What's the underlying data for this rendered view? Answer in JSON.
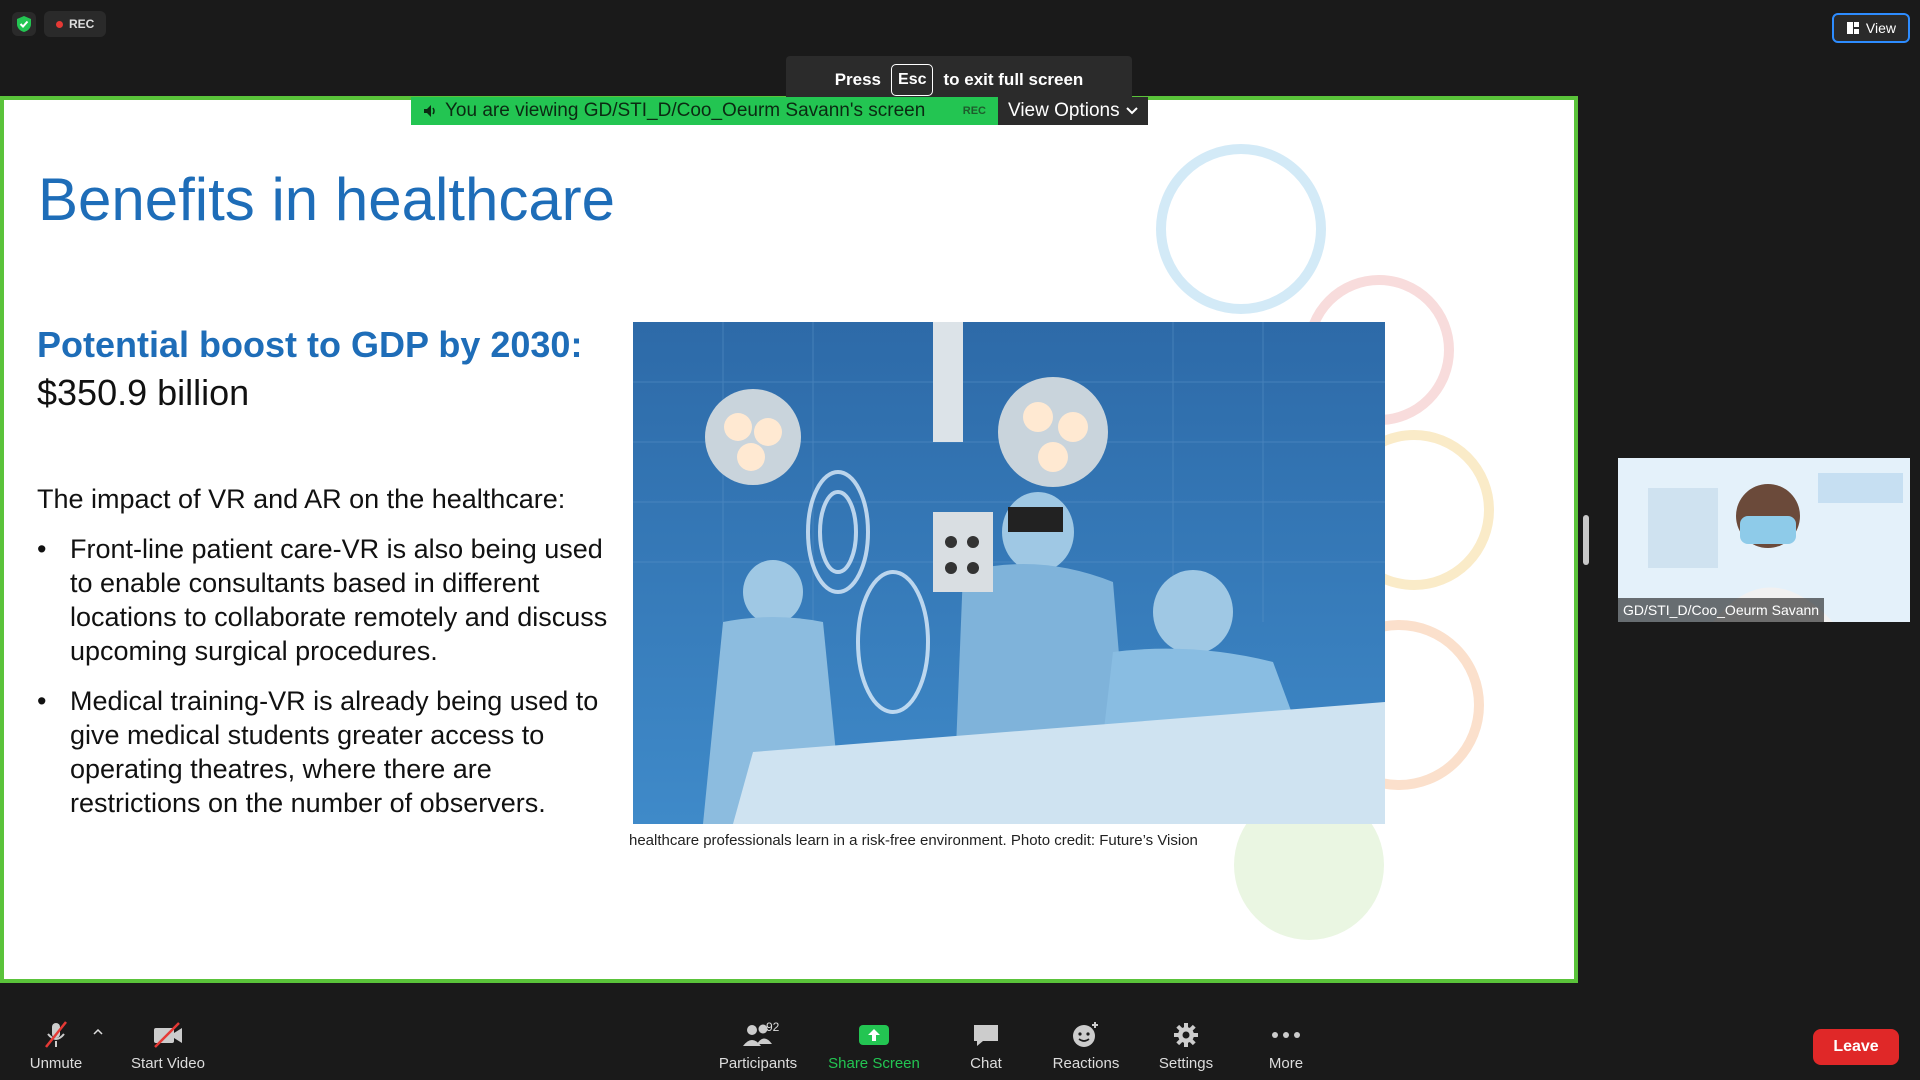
{
  "top": {
    "rec_label": "REC",
    "view_label": "View",
    "esc_press": "Press",
    "esc_key": "Esc",
    "esc_exit": "to exit full screen"
  },
  "share": {
    "viewing_text": "You are viewing GD/STI_D/Coo_Oeurm Savann's screen",
    "rec_mini": "REC",
    "view_options": "View Options",
    "frame_color": "#5ac33a"
  },
  "slide": {
    "title": "Benefits in healthcare",
    "gdp_heading": "Potential boost to GDP by 2030:",
    "gdp_value": "$350.9 billion",
    "impact": "The impact of VR and AR on the healthcare:",
    "bullets": [
      " Front-line patient care-VR is also being used to enable consultants based in different locations to collaborate remotely and discuss upcoming surgical procedures.",
      " Medical training-VR is already being used to give medical students greater access to operating theatres, where there are restrictions on the number of observers."
    ],
    "bullet_marker": "•",
    "caption": "healthcare professionals learn in a risk-free environment. Photo credit: Future’s Vision",
    "accent_color": "#1e6db8"
  },
  "participant": {
    "name": "GD/STI_D/Coo_Oeurm Savann"
  },
  "toolbar": {
    "unmute": "Unmute",
    "start_video": "Start Video",
    "participants": "Participants",
    "participants_count": "92",
    "share_screen": "Share Screen",
    "chat": "Chat",
    "reactions": "Reactions",
    "settings": "Settings",
    "more": "More",
    "leave": "Leave"
  }
}
